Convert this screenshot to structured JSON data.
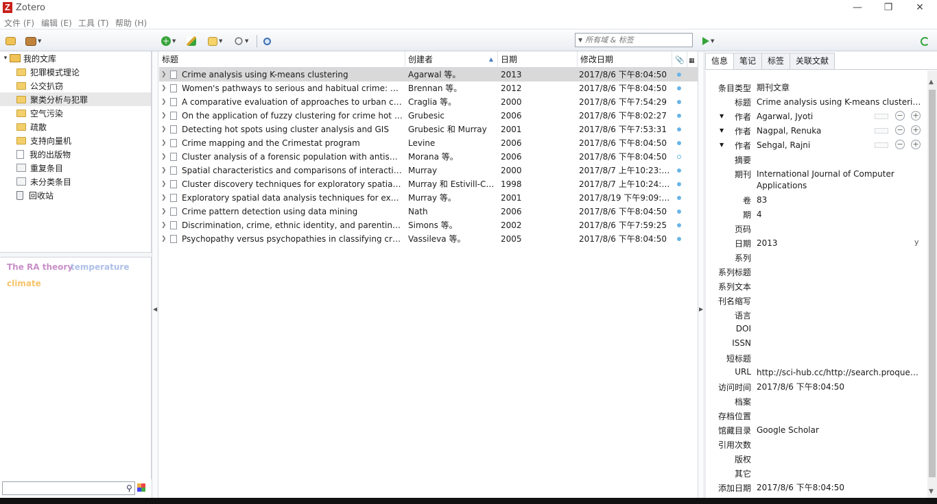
{
  "window": {
    "app_name": "Zotero",
    "logo_letter": "Z"
  },
  "menu": [
    "文件 (F)",
    "编辑 (E)",
    "工具 (T)",
    "帮助 (H)"
  ],
  "search": {
    "placeholder": "所有域 & 标签"
  },
  "collections": [
    {
      "label": "我的文库",
      "type": "library"
    },
    {
      "label": "犯罪模式理论",
      "type": "folder"
    },
    {
      "label": "公交扒窃",
      "type": "folder"
    },
    {
      "label": "聚类分析与犯罪",
      "type": "folder",
      "selected": true
    },
    {
      "label": "空气污染",
      "type": "folder"
    },
    {
      "label": "疏散",
      "type": "folder"
    },
    {
      "label": "支持向量机",
      "type": "folder"
    },
    {
      "label": "我的出版物",
      "type": "doc"
    },
    {
      "label": "重复条目",
      "type": "duplicate"
    },
    {
      "label": "未分类条目",
      "type": "unfiled"
    },
    {
      "label": "回收站",
      "type": "trash"
    }
  ],
  "tags": [
    {
      "label": "The RA theory",
      "color": "#c98fc8"
    },
    {
      "label": "temperature",
      "color": "#aebfe8"
    },
    {
      "label": "climate",
      "color": "#f5c46a"
    }
  ],
  "columns": {
    "title": "标题",
    "creator": "创建者",
    "date": "日期",
    "modified": "修改日期"
  },
  "items": [
    {
      "title": "Crime analysis using K-means clustering",
      "creator": "Agarwal 等。",
      "date": "2013",
      "modified": "2017/8/6 下午8:04:50",
      "selected": true
    },
    {
      "title": "Women's pathways to serious and habitual crime: A pe...",
      "creator": "Brennan 等。",
      "date": "2012",
      "modified": "2017/8/6 下午8:04:50"
    },
    {
      "title": "A comparative evaluation of approaches to urban crim...",
      "creator": "Craglia 等。",
      "date": "2000",
      "modified": "2017/8/6 下午7:54:29"
    },
    {
      "title": "On the application of fuzzy clustering for crime hot sp...",
      "creator": "Grubesic",
      "date": "2006",
      "modified": "2017/8/6 下午8:02:27"
    },
    {
      "title": "Detecting hot spots using cluster analysis and GIS",
      "creator": "Grubesic 和 Murray",
      "date": "2001",
      "modified": "2017/8/6 下午7:53:31"
    },
    {
      "title": "Crime mapping and the Crimestat program",
      "creator": "Levine",
      "date": "2006",
      "modified": "2017/8/6 下午8:04:50"
    },
    {
      "title": "Cluster analysis of a forensic population with antisocial...",
      "creator": "Morana 等。",
      "date": "2006",
      "modified": "2017/8/6 下午8:04:50",
      "hollow": true
    },
    {
      "title": "Spatial characteristics and comparisons of interaction ...",
      "creator": "Murray",
      "date": "2000",
      "modified": "2017/8/7 上午10:23:21"
    },
    {
      "title": "Cluster discovery techniques for exploratory spatial da...",
      "creator": "Murray 和 Estivill-Ca...",
      "date": "1998",
      "modified": "2017/8/7 上午10:24:49"
    },
    {
      "title": "Exploratory spatial data analysis techniques for examin...",
      "creator": "Murray 等。",
      "date": "2001",
      "modified": "2017/8/19 下午9:09:26"
    },
    {
      "title": "Crime pattern detection using data mining",
      "creator": "Nath",
      "date": "2006",
      "modified": "2017/8/6 下午8:04:50"
    },
    {
      "title": "Discrimination, crime, ethnic identity, and parenting as...",
      "creator": "Simons 等。",
      "date": "2002",
      "modified": "2017/8/6 下午7:59:25"
    },
    {
      "title": "Psychopathy versus psychopathies in classifying crimin...",
      "creator": "Vassileva 等。",
      "date": "2005",
      "modified": "2017/8/6 下午8:04:50"
    }
  ],
  "tabs": [
    "信息",
    "笔记",
    "标签",
    "关联文献"
  ],
  "info": {
    "item_type": {
      "label": "条目类型",
      "value": "期刊文章"
    },
    "title": {
      "label": "标题",
      "value": "Crime analysis using K-means clustering"
    },
    "creators": [
      {
        "role": "作者",
        "name": "Agarwal, Jyoti"
      },
      {
        "role": "作者",
        "name": "Nagpal, Renuka"
      },
      {
        "role": "作者",
        "name": "Sehgal, Rajni"
      }
    ],
    "fields": [
      {
        "label": "摘要",
        "value": ""
      },
      {
        "label": "期刊",
        "value": "International Journal of Computer Applications",
        "tall": true
      },
      {
        "label": "卷",
        "value": "83"
      },
      {
        "label": "期",
        "value": "4"
      },
      {
        "label": "页码",
        "value": ""
      },
      {
        "label": "日期",
        "value": "2013",
        "ymark": "y"
      },
      {
        "label": "系列",
        "value": ""
      },
      {
        "label": "系列标题",
        "value": ""
      },
      {
        "label": "系列文本",
        "value": ""
      },
      {
        "label": "刊名缩写",
        "value": ""
      },
      {
        "label": "语言",
        "value": ""
      },
      {
        "label": "DOI",
        "value": ""
      },
      {
        "label": "ISSN",
        "value": ""
      },
      {
        "label": "短标题",
        "value": ""
      },
      {
        "label": "URL",
        "value": "http://sci-hub.cc/http://search.proques..."
      },
      {
        "label": "访问时间",
        "value": "2017/8/6 下午8:04:50"
      },
      {
        "label": "档案",
        "value": ""
      },
      {
        "label": "存档位置",
        "value": ""
      },
      {
        "label": "馆藏目录",
        "value": "Google Scholar"
      },
      {
        "label": "引用次数",
        "value": ""
      },
      {
        "label": "版权",
        "value": ""
      },
      {
        "label": "其它",
        "value": ""
      },
      {
        "label": "添加日期",
        "value": "2017/8/6 下午8:04:50"
      }
    ]
  },
  "colors": {
    "toolbar_green": "#37a43a",
    "selected_row": "#d9d9d9",
    "attachment_dot": "#69b4e8"
  }
}
